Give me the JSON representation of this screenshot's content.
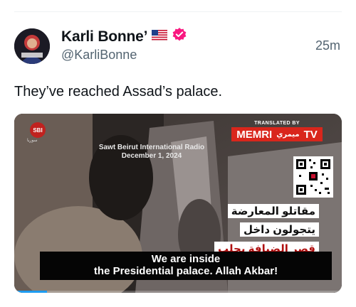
{
  "tweet": {
    "display_name": "Karli Bonne’",
    "flag": "🇺🇸",
    "handle": "@KarliBonne",
    "timestamp": "25m",
    "text": "They’ve reached Assad’s palace.",
    "verified_color": "#f91880"
  },
  "media": {
    "channel_logo": "SBI",
    "channel_logo_sub": "سوريا",
    "station_line1": "Sawt Beirut International Radio",
    "station_line2": "December 1, 2024",
    "translated_by": "TRANSLATED BY",
    "memri": "MEMRI",
    "memri_ar": "ميمري",
    "memri_tv": "TV",
    "arabic_caption_1": "مقاتلو المعارضة",
    "arabic_caption_2": "يتجولون داخل",
    "arabic_caption_3": "قصر الضيافة بحلب",
    "english_caption_1": "We are inside",
    "english_caption_2": "the Presidential palace. Allah Akbar!",
    "progress_fraction": 0.1
  }
}
